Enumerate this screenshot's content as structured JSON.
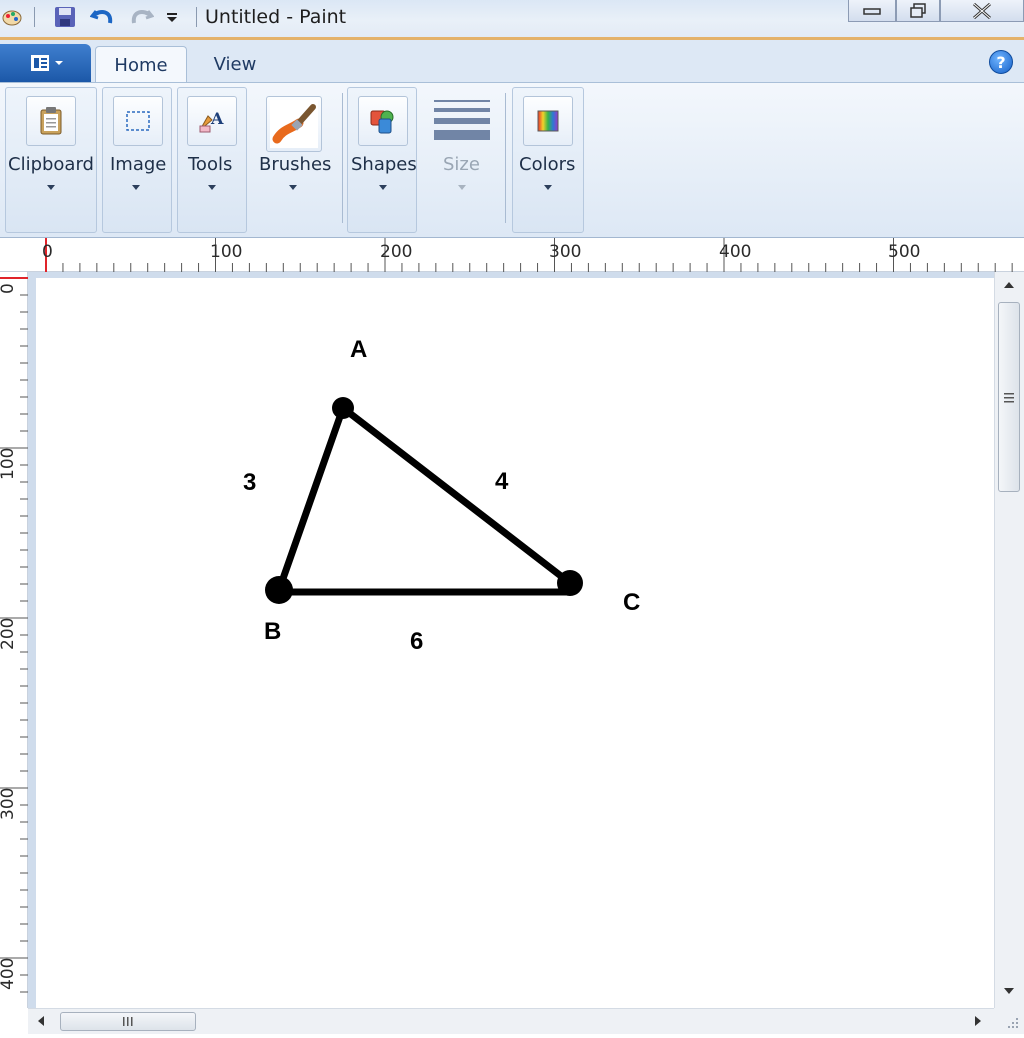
{
  "window": {
    "title": "Untitled - Paint",
    "controls": {
      "minimize": "minimize-button",
      "restore": "restore-button",
      "close": "close-button"
    }
  },
  "quick_access": [
    "paint-app-icon",
    "save-icon",
    "undo-icon",
    "redo-icon",
    "customize-icon"
  ],
  "tabs": [
    {
      "label": "Home",
      "active": true
    },
    {
      "label": "View",
      "active": false
    }
  ],
  "ribbon": {
    "groups": [
      {
        "label": "Clipboard",
        "icon": "clipboard-icon",
        "enabled": true
      },
      {
        "label": "Image",
        "icon": "select-icon",
        "enabled": true
      },
      {
        "label": "Tools",
        "icon": "tools-icon",
        "enabled": true
      },
      {
        "label": "Brushes",
        "icon": "brush-icon",
        "enabled": true
      },
      {
        "label": "Shapes",
        "icon": "shapes-icon",
        "enabled": true
      },
      {
        "label": "Size",
        "icon": "size-icon",
        "enabled": false
      },
      {
        "label": "Colors",
        "icon": "colors-icon",
        "enabled": true
      }
    ]
  },
  "rulers": {
    "horizontal": [
      "0",
      "100",
      "200",
      "300",
      "400",
      "500"
    ],
    "vertical": [
      "0",
      "100",
      "200",
      "300",
      "400"
    ]
  },
  "drawing": {
    "vertex_labels": {
      "a": "A",
      "b": "B",
      "c": "C"
    },
    "side_labels": {
      "ab": "3",
      "ac": "4",
      "bc": "6"
    }
  },
  "colors": {
    "title_accent": "#e4b26a",
    "app_button": "#1c58a8",
    "ink": "#000000"
  }
}
